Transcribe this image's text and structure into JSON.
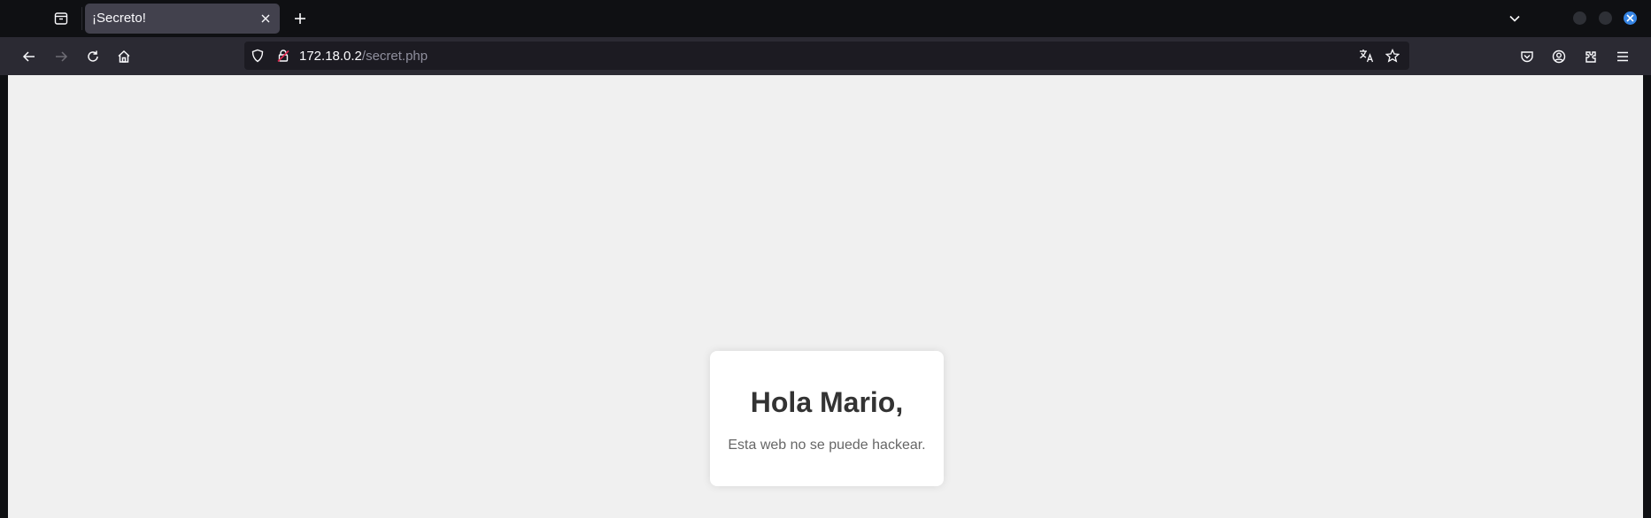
{
  "browser": {
    "tab": {
      "title": "¡Secreto!"
    },
    "url": {
      "host": "172.18.0.2",
      "path": "/secret.php"
    },
    "icons": {
      "tab_list": "firefox-view-icon",
      "tab_close": "close-icon",
      "new_tab": "plus-icon",
      "tab_menu": "chevron-down-icon",
      "back": "back-arrow-icon",
      "forward": "forward-arrow-icon",
      "reload": "reload-icon",
      "home": "home-icon",
      "tracking": "shield-icon",
      "insecure": "insecure-lock-icon",
      "translate": "translate-icon",
      "bookmark": "star-icon",
      "pocket": "pocket-icon",
      "account": "account-icon",
      "extensions": "extensions-icon",
      "menu": "hamburger-menu-icon"
    },
    "colors": {
      "window_close": "#3584e4",
      "insecure_accent": "#e22850"
    }
  },
  "page": {
    "heading": "Hola Mario,",
    "message": "Esta web no se puede hackear."
  }
}
